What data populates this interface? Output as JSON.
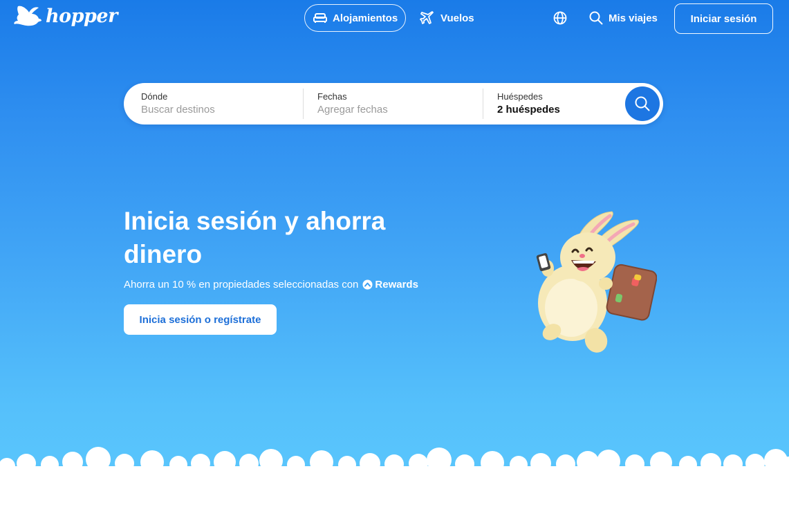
{
  "brand": {
    "name": "hopper"
  },
  "nav": {
    "stays_label": "Alojamientos",
    "flights_label": "Vuelos",
    "trips_label": "Mis viajes",
    "signin_label": "Iniciar sesión"
  },
  "search": {
    "where_label": "Dónde",
    "where_placeholder": "Buscar destinos",
    "dates_label": "Fechas",
    "dates_placeholder": "Agregar fechas",
    "guests_label": "Huéspedes",
    "guests_value": "2 huéspedes"
  },
  "promo": {
    "title": "Inicia sesión y ahorra dinero",
    "subtitle": "Ahorra un 10 % en propiedades seleccionadas con",
    "rewards_label": "Rewards",
    "cta_label": "Inicia sesión o regístrate"
  },
  "colors": {
    "primary": "#1d76e2",
    "sky_top": "#1a7be8",
    "sky_bottom": "#5ac6fc",
    "white": "#ffffff"
  },
  "icons": [
    "bunny-logo-icon",
    "bed-icon",
    "plane-icon",
    "globe-icon",
    "search-icon",
    "rewards-icon",
    "bunny-mascot"
  ]
}
